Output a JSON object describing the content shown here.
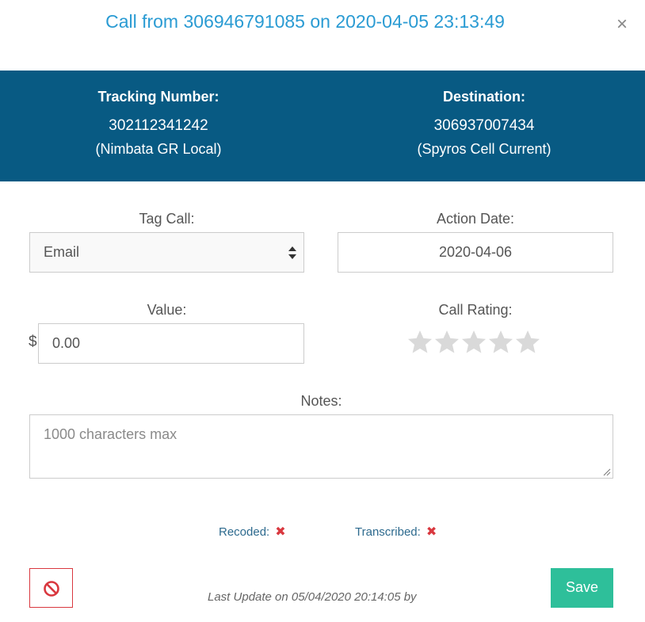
{
  "modal": {
    "title": "Call from 306946791085 on 2020-04-05 23:13:49",
    "close_glyph": "×",
    "close_icon": "close-icon"
  },
  "info": {
    "tracking": {
      "label": "Tracking Number:",
      "number": "302112341242",
      "name": "(Nimbata GR Local)"
    },
    "destination": {
      "label": "Destination:",
      "number": "306937007434",
      "name": "(Spyros Cell Current)"
    },
    "band_color": "#085a83"
  },
  "form": {
    "tag_call": {
      "label": "Tag Call:",
      "selected": "Email"
    },
    "action_date": {
      "label": "Action Date:",
      "value": "2020-04-06"
    },
    "value": {
      "label": "Value:",
      "currency": "$",
      "amount": "0.00"
    },
    "call_rating": {
      "label": "Call Rating:",
      "stars_total": 5,
      "stars_filled": 0
    },
    "notes": {
      "label": "Notes:",
      "placeholder": "1000 characters max"
    }
  },
  "status": {
    "recoded_label": "Recoded:",
    "transcribed_label": "Transcribed:",
    "mark": "✖"
  },
  "footer": {
    "last_update": "Last Update on 05/04/2020 20:14:05 by",
    "save_label": "Save",
    "cancel_icon": "ban-icon"
  },
  "colors": {
    "title": "#2a9bd3",
    "save": "#2ebf9a",
    "danger": "#d9383f",
    "star_empty": "#d9d9d9"
  }
}
